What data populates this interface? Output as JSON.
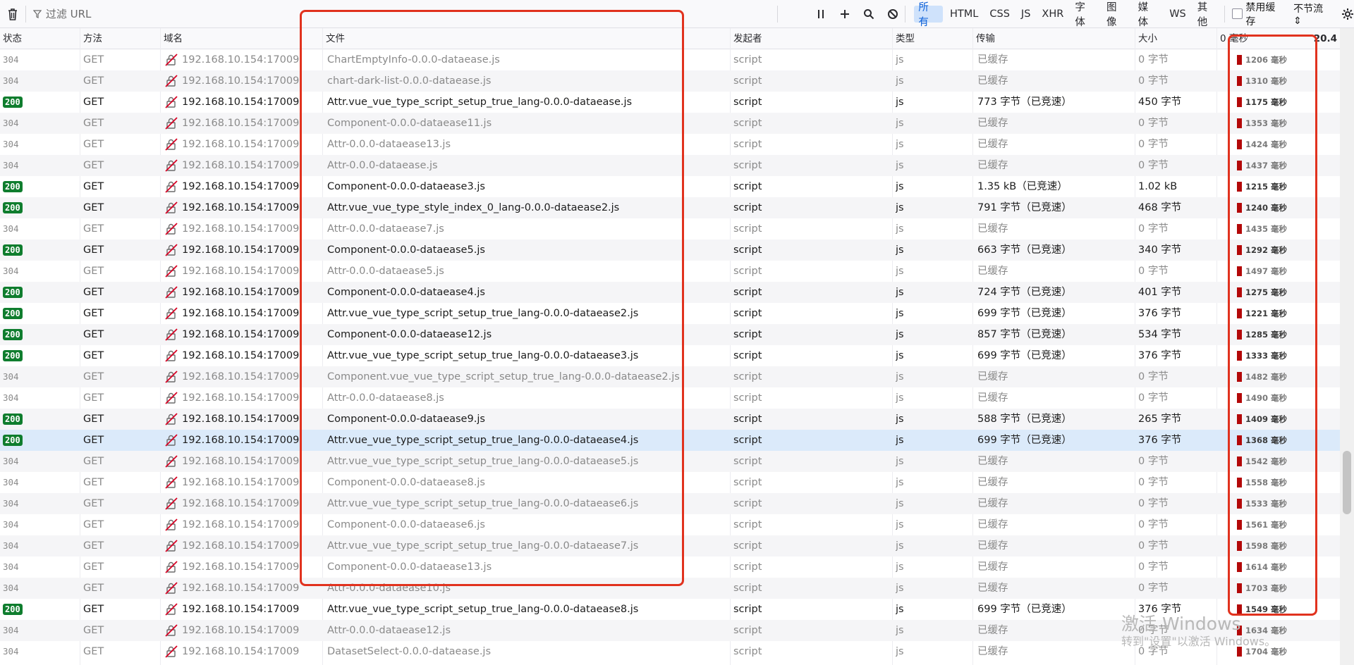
{
  "toolbar": {
    "filter_placeholder": "过滤 URL",
    "pause_icon": "pause-icon",
    "types": [
      "所有",
      "HTML",
      "CSS",
      "JS",
      "XHR",
      "字体",
      "图像",
      "媒体",
      "WS",
      "其他"
    ],
    "disable_cache_label": "禁用缓存",
    "throttle_label": "不节流 ⇕"
  },
  "header": {
    "status": "状态",
    "method": "方法",
    "domain": "域名",
    "file": "文件",
    "initiator": "发起者",
    "type": "类型",
    "transfer": "传输",
    "size": "大小",
    "waterfall_start": "0 毫秒",
    "waterfall_end": "20.4"
  },
  "rows": [
    {
      "status": "304",
      "method": "GET",
      "domain": "192.168.10.154:17009",
      "file": "ChartEmptyInfo-0.0.0-dataease.js",
      "initiator": "script",
      "type": "js",
      "transfer": "已缓存",
      "size": "0 字节",
      "time": "1206 毫秒"
    },
    {
      "status": "304",
      "method": "GET",
      "domain": "192.168.10.154:17009",
      "file": "chart-dark-list-0.0.0-dataease.js",
      "initiator": "script",
      "type": "js",
      "transfer": "已缓存",
      "size": "0 字节",
      "time": "1310 毫秒"
    },
    {
      "status": "200",
      "method": "GET",
      "domain": "192.168.10.154:17009",
      "file": "Attr.vue_vue_type_script_setup_true_lang-0.0.0-dataease.js",
      "initiator": "script",
      "type": "js",
      "transfer": "773 字节（已竞速）",
      "size": "450 字节",
      "time": "1175 毫秒"
    },
    {
      "status": "304",
      "method": "GET",
      "domain": "192.168.10.154:17009",
      "file": "Component-0.0.0-dataease11.js",
      "initiator": "script",
      "type": "js",
      "transfer": "已缓存",
      "size": "0 字节",
      "time": "1353 毫秒"
    },
    {
      "status": "304",
      "method": "GET",
      "domain": "192.168.10.154:17009",
      "file": "Attr-0.0.0-dataease13.js",
      "initiator": "script",
      "type": "js",
      "transfer": "已缓存",
      "size": "0 字节",
      "time": "1424 毫秒"
    },
    {
      "status": "304",
      "method": "GET",
      "domain": "192.168.10.154:17009",
      "file": "Attr-0.0.0-dataease.js",
      "initiator": "script",
      "type": "js",
      "transfer": "已缓存",
      "size": "0 字节",
      "time": "1437 毫秒"
    },
    {
      "status": "200",
      "method": "GET",
      "domain": "192.168.10.154:17009",
      "file": "Component-0.0.0-dataease3.js",
      "initiator": "script",
      "type": "js",
      "transfer": "1.35 kB（已竞速）",
      "size": "1.02 kB",
      "time": "1215 毫秒"
    },
    {
      "status": "200",
      "method": "GET",
      "domain": "192.168.10.154:17009",
      "file": "Attr.vue_vue_type_style_index_0_lang-0.0.0-dataease2.js",
      "initiator": "script",
      "type": "js",
      "transfer": "791 字节（已竞速）",
      "size": "468 字节",
      "time": "1240 毫秒"
    },
    {
      "status": "304",
      "method": "GET",
      "domain": "192.168.10.154:17009",
      "file": "Attr-0.0.0-dataease7.js",
      "initiator": "script",
      "type": "js",
      "transfer": "已缓存",
      "size": "0 字节",
      "time": "1435 毫秒"
    },
    {
      "status": "200",
      "method": "GET",
      "domain": "192.168.10.154:17009",
      "file": "Component-0.0.0-dataease5.js",
      "initiator": "script",
      "type": "js",
      "transfer": "663 字节（已竞速）",
      "size": "340 字节",
      "time": "1292 毫秒"
    },
    {
      "status": "304",
      "method": "GET",
      "domain": "192.168.10.154:17009",
      "file": "Attr-0.0.0-dataease5.js",
      "initiator": "script",
      "type": "js",
      "transfer": "已缓存",
      "size": "0 字节",
      "time": "1497 毫秒"
    },
    {
      "status": "200",
      "method": "GET",
      "domain": "192.168.10.154:17009",
      "file": "Component-0.0.0-dataease4.js",
      "initiator": "script",
      "type": "js",
      "transfer": "724 字节（已竞速）",
      "size": "401 字节",
      "time": "1275 毫秒"
    },
    {
      "status": "200",
      "method": "GET",
      "domain": "192.168.10.154:17009",
      "file": "Attr.vue_vue_type_script_setup_true_lang-0.0.0-dataease2.js",
      "initiator": "script",
      "type": "js",
      "transfer": "699 字节（已竞速）",
      "size": "376 字节",
      "time": "1221 毫秒"
    },
    {
      "status": "200",
      "method": "GET",
      "domain": "192.168.10.154:17009",
      "file": "Component-0.0.0-dataease12.js",
      "initiator": "script",
      "type": "js",
      "transfer": "857 字节（已竞速）",
      "size": "534 字节",
      "time": "1285 毫秒"
    },
    {
      "status": "200",
      "method": "GET",
      "domain": "192.168.10.154:17009",
      "file": "Attr.vue_vue_type_script_setup_true_lang-0.0.0-dataease3.js",
      "initiator": "script",
      "type": "js",
      "transfer": "699 字节（已竞速）",
      "size": "376 字节",
      "time": "1333 毫秒"
    },
    {
      "status": "304",
      "method": "GET",
      "domain": "192.168.10.154:17009",
      "file": "Component.vue_vue_type_script_setup_true_lang-0.0.0-dataease2.js",
      "initiator": "script",
      "type": "js",
      "transfer": "已缓存",
      "size": "0 字节",
      "time": "1482 毫秒"
    },
    {
      "status": "304",
      "method": "GET",
      "domain": "192.168.10.154:17009",
      "file": "Attr-0.0.0-dataease8.js",
      "initiator": "script",
      "type": "js",
      "transfer": "已缓存",
      "size": "0 字节",
      "time": "1490 毫秒"
    },
    {
      "status": "200",
      "method": "GET",
      "domain": "192.168.10.154:17009",
      "file": "Component-0.0.0-dataease9.js",
      "initiator": "script",
      "type": "js",
      "transfer": "588 字节（已竞速）",
      "size": "265 字节",
      "time": "1409 毫秒"
    },
    {
      "status": "200",
      "method": "GET",
      "domain": "192.168.10.154:17009",
      "file": "Attr.vue_vue_type_script_setup_true_lang-0.0.0-dataease4.js",
      "initiator": "script",
      "type": "js",
      "transfer": "699 字节（已竞速）",
      "size": "376 字节",
      "time": "1368 毫秒",
      "selected": true
    },
    {
      "status": "304",
      "method": "GET",
      "domain": "192.168.10.154:17009",
      "file": "Attr.vue_vue_type_script_setup_true_lang-0.0.0-dataease5.js",
      "initiator": "script",
      "type": "js",
      "transfer": "已缓存",
      "size": "0 字节",
      "time": "1542 毫秒"
    },
    {
      "status": "304",
      "method": "GET",
      "domain": "192.168.10.154:17009",
      "file": "Component-0.0.0-dataease8.js",
      "initiator": "script",
      "type": "js",
      "transfer": "已缓存",
      "size": "0 字节",
      "time": "1558 毫秒"
    },
    {
      "status": "304",
      "method": "GET",
      "domain": "192.168.10.154:17009",
      "file": "Attr.vue_vue_type_script_setup_true_lang-0.0.0-dataease6.js",
      "initiator": "script",
      "type": "js",
      "transfer": "已缓存",
      "size": "0 字节",
      "time": "1533 毫秒"
    },
    {
      "status": "304",
      "method": "GET",
      "domain": "192.168.10.154:17009",
      "file": "Component-0.0.0-dataease6.js",
      "initiator": "script",
      "type": "js",
      "transfer": "已缓存",
      "size": "0 字节",
      "time": "1561 毫秒"
    },
    {
      "status": "304",
      "method": "GET",
      "domain": "192.168.10.154:17009",
      "file": "Attr.vue_vue_type_script_setup_true_lang-0.0.0-dataease7.js",
      "initiator": "script",
      "type": "js",
      "transfer": "已缓存",
      "size": "0 字节",
      "time": "1598 毫秒"
    },
    {
      "status": "304",
      "method": "GET",
      "domain": "192.168.10.154:17009",
      "file": "Component-0.0.0-dataease13.js",
      "initiator": "script",
      "type": "js",
      "transfer": "已缓存",
      "size": "0 字节",
      "time": "1614 毫秒"
    },
    {
      "status": "304",
      "method": "GET",
      "domain": "192.168.10.154:17009",
      "file": "Attr-0.0.0-dataease10.js",
      "initiator": "script",
      "type": "js",
      "transfer": "已缓存",
      "size": "0 字节",
      "time": "1703 毫秒"
    },
    {
      "status": "200",
      "method": "GET",
      "domain": "192.168.10.154:17009",
      "file": "Attr.vue_vue_type_script_setup_true_lang-0.0.0-dataease8.js",
      "initiator": "script",
      "type": "js",
      "transfer": "699 字节（已竞速）",
      "size": "376 字节",
      "time": "1549 毫秒"
    },
    {
      "status": "304",
      "method": "GET",
      "domain": "192.168.10.154:17009",
      "file": "Attr-0.0.0-dataease12.js",
      "initiator": "script",
      "type": "js",
      "transfer": "已缓存",
      "size": "0 字节",
      "time": "1634 毫秒"
    },
    {
      "status": "304",
      "method": "GET",
      "domain": "192.168.10.154:17009",
      "file": "DatasetSelect-0.0.0-dataease.js",
      "initiator": "script",
      "type": "js",
      "transfer": "已缓存",
      "size": "0 字节",
      "time": "1704 毫秒"
    }
  ],
  "watermark": {
    "line1": "激活 Windows",
    "line2": "转到\"设置\"以激活 Windows。"
  },
  "colors": {
    "status_200_badge": "#0f7d2e",
    "waterfall_bar": "#b30909",
    "annotation_box": "#e1321e",
    "selected_row": "#dbeafa",
    "active_filter": "#cfe2fb"
  }
}
